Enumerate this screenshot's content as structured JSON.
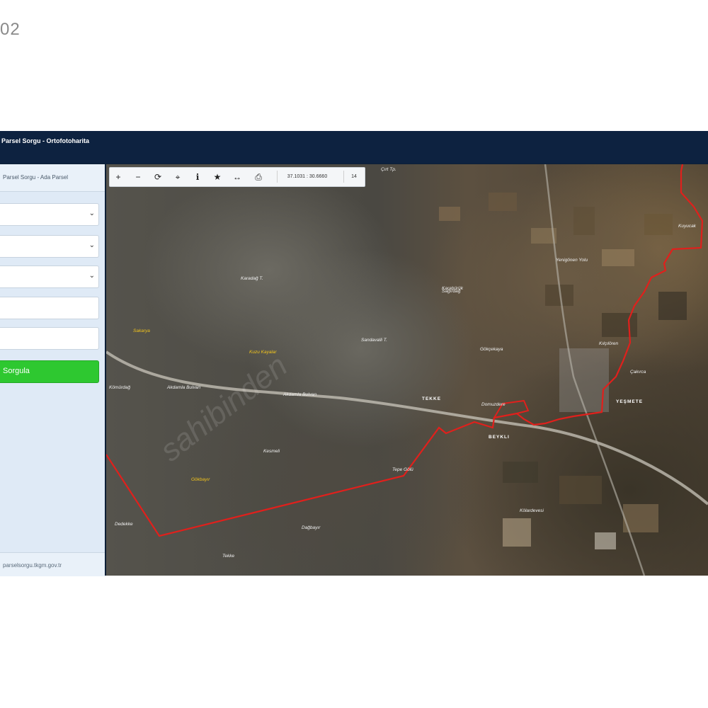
{
  "corner_number": "02",
  "app": {
    "title": "Parsel Sorgu - Ortofotoharita"
  },
  "sidebar": {
    "header": "Parsel Sorgu - Ada Parsel",
    "selects": [
      {
        "chevron_icon": "chevron-down-icon"
      },
      {
        "chevron_icon": "chevron-down-icon"
      },
      {
        "chevron_icon": "chevron-down-icon"
      }
    ],
    "inputs": [
      {
        "value": ""
      },
      {
        "value": ""
      }
    ],
    "button_label": "Sorgula",
    "footer": "parselsorgu.tkgm.gov.tr"
  },
  "toolbar": {
    "buttons": [
      {
        "icon": "zoom-in-icon",
        "glyph": "+"
      },
      {
        "icon": "zoom-out-icon",
        "glyph": "−"
      },
      {
        "icon": "refresh-icon",
        "glyph": "⟳"
      },
      {
        "icon": "locate-icon",
        "glyph": "⌖"
      },
      {
        "icon": "info-icon",
        "glyph": "ℹ"
      },
      {
        "icon": "star-icon",
        "glyph": "★"
      },
      {
        "icon": "measure-icon",
        "glyph": "↔"
      },
      {
        "icon": "print-icon",
        "glyph": "⎙"
      }
    ],
    "coordinates": "37.1031 : 30.6660",
    "zoom_level": "14"
  },
  "map": {
    "labels": [
      {
        "text": "Çırt Tp.",
        "style": "w"
      },
      {
        "text": "Karadağ T.",
        "style": "w"
      },
      {
        "text": "Karabürük",
        "style": "w"
      },
      {
        "text": "Sandavalli T.",
        "style": "w"
      },
      {
        "text": "Kuzu Kayalar",
        "style": "y"
      },
      {
        "text": "Sakarya",
        "style": "y"
      },
      {
        "text": "Kömürdağ",
        "style": "w"
      },
      {
        "text": "Akdamla Bulvarı",
        "style": "w"
      },
      {
        "text": "Akdamla Bulvarı",
        "style": "w"
      },
      {
        "text": "Kesmeli",
        "style": "w"
      },
      {
        "text": "Gökbayır",
        "style": "y"
      },
      {
        "text": "Dedekke",
        "style": "w"
      },
      {
        "text": "Dağbayır",
        "style": "w"
      },
      {
        "text": "Tekke",
        "style": "w"
      },
      {
        "text": "Yenigönen Yolu",
        "style": "w"
      },
      {
        "text": "Sağırdağ",
        "style": "w"
      },
      {
        "text": "Gökçekaya",
        "style": "w"
      },
      {
        "text": "Domuzdere",
        "style": "w"
      },
      {
        "text": "Kılçılören",
        "style": "w"
      },
      {
        "text": "Çakırca",
        "style": "w"
      },
      {
        "text": "Kölardevesi",
        "style": "w"
      },
      {
        "text": "Tepe Gölü",
        "style": "w"
      },
      {
        "text": "Kuyucak",
        "style": "w"
      },
      {
        "text": "BEYKLI",
        "style": "b"
      },
      {
        "text": "YEŞMETE",
        "style": "b"
      },
      {
        "text": "TEKKE",
        "style": "b"
      }
    ],
    "watermark": "sahibinden"
  },
  "colors": {
    "boundary": "#e0201c",
    "accent_button": "#2ec830",
    "topbar": "#0d2240"
  }
}
